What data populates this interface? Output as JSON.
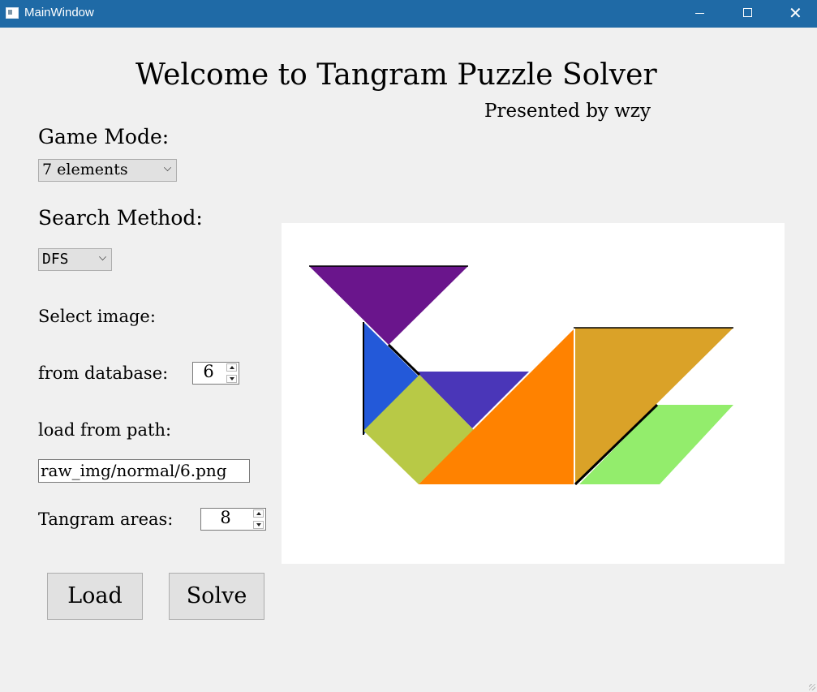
{
  "window": {
    "title": "MainWindow",
    "controls": {
      "minimize": "minimize-icon",
      "maximize": "maximize-icon",
      "close": "close-icon"
    }
  },
  "header": {
    "title": "Welcome to Tangram Puzzle Solver",
    "subtitle": "Presented by wzy"
  },
  "game_mode": {
    "label": "Game Mode:",
    "selected": "7 elements"
  },
  "search_method": {
    "label": "Search Method:",
    "selected": "DFS"
  },
  "select_image": {
    "label": "Select image:"
  },
  "database": {
    "label": "from database:",
    "value": "6"
  },
  "load_path": {
    "label": "load from path:",
    "value": "raw_img/normal/6.png"
  },
  "areas": {
    "label": "Tangram areas:",
    "value": "8"
  },
  "buttons": {
    "load": "Load",
    "solve": "Solve"
  },
  "puzzle": {
    "pieces": [
      {
        "name": "purple-large-triangle",
        "color": "#6a158c"
      },
      {
        "name": "blue-small-triangle",
        "color": "#2359d9"
      },
      {
        "name": "indigo-small-triangle",
        "color": "#4a36b8"
      },
      {
        "name": "olive-square",
        "color": "#b8c946"
      },
      {
        "name": "orange-large-triangle",
        "color": "#ff8200"
      },
      {
        "name": "gold-parallelogram",
        "color": "#daa228"
      },
      {
        "name": "green-parallelogram",
        "color": "#93ed6c"
      }
    ],
    "background": "#ffffff"
  }
}
